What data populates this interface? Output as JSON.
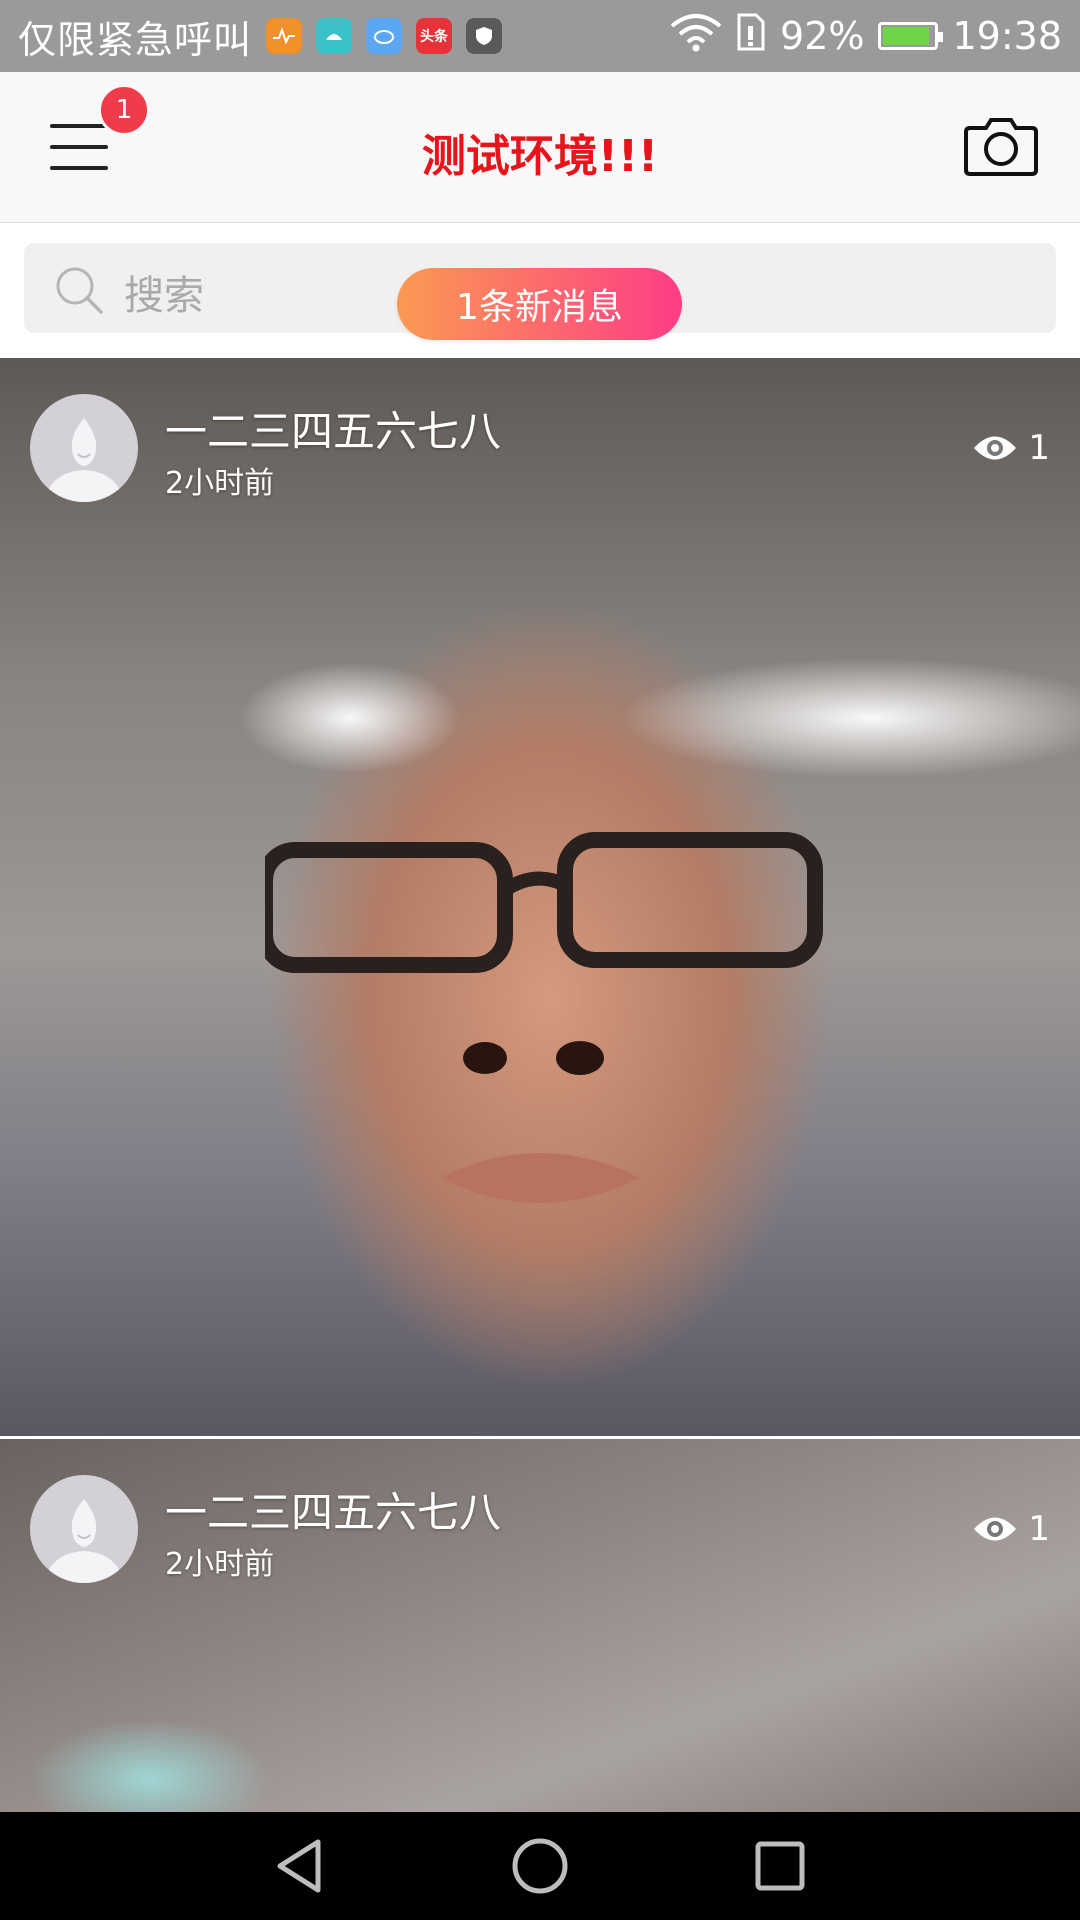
{
  "status_bar": {
    "carrier": "仅限紧急呼叫",
    "battery_percent": "92%",
    "time": "19:38",
    "battery_level": 0.92,
    "notification_icons": [
      {
        "name": "health-app-icon",
        "color": "#f0902a"
      },
      {
        "name": "android-app-icon",
        "color": "#3bc2c9"
      },
      {
        "name": "cloud-app-icon",
        "color": "#5aa6f0"
      },
      {
        "name": "toutiao-app-icon",
        "label": "头条",
        "color": "#e8323a"
      },
      {
        "name": "shield-app-icon",
        "color": "#5a5a5a"
      }
    ]
  },
  "header": {
    "title": "测试环境!!!",
    "menu_badge": "1"
  },
  "search": {
    "placeholder": "搜索",
    "new_message_pill": "1条新消息"
  },
  "posts": [
    {
      "author": "一二三四五六七八",
      "time": "2小时前",
      "views": "1"
    },
    {
      "author": "一二三四五六七八",
      "time": "2小时前",
      "views": "1"
    }
  ],
  "colors": {
    "title_red": "#e8141b",
    "badge_red": "#f03b4a",
    "pill_gradient_start": "#fb9a52",
    "pill_gradient_end": "#fd3d86"
  }
}
